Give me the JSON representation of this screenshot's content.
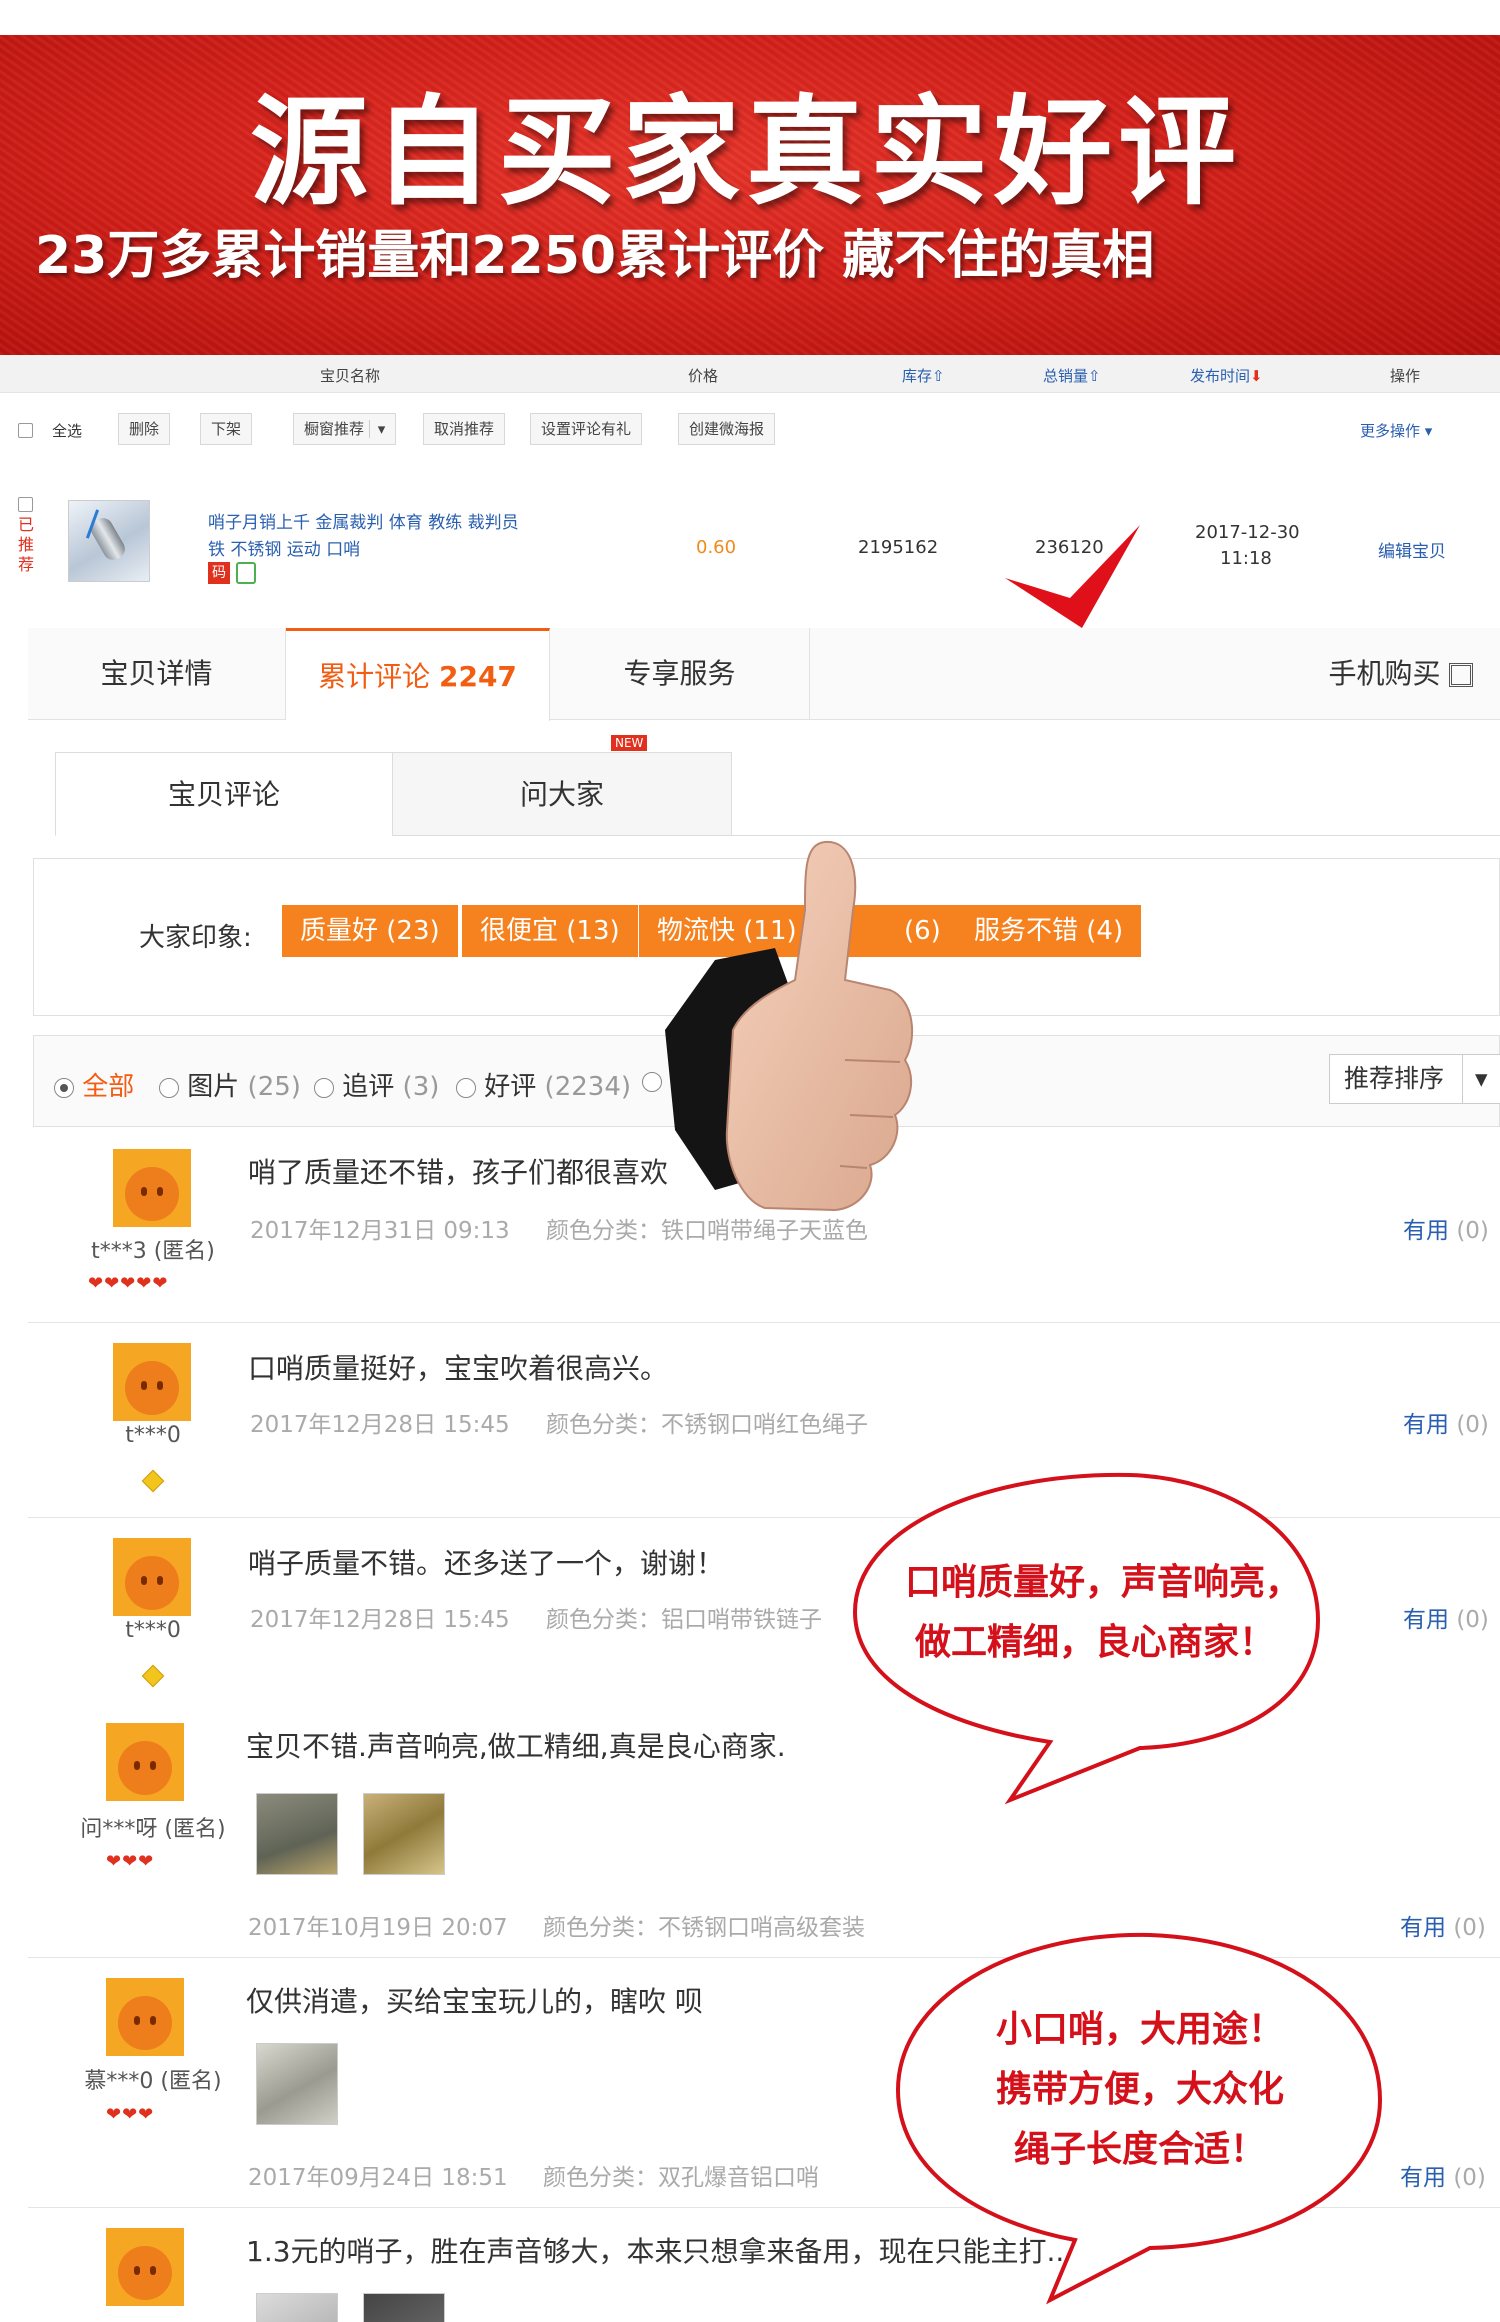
{
  "banner": {
    "title": "源自买家真实好评",
    "subtitle": "23万多累计销量和2250累计评价 藏不住的真相"
  },
  "table": {
    "headers": {
      "name": "宝贝名称",
      "price": "价格",
      "stock": "库存",
      "sales": "总销量",
      "publish_time": "发布时间",
      "ops": "操作"
    },
    "toolbar": {
      "select_all": "全选",
      "delete": "删除",
      "unlist": "下架",
      "shop_recommend": "橱窗推荐",
      "cancel_recommend": "取消推荐",
      "review_gift": "设置评论有礼",
      "create_poster": "创建微海报",
      "more_ops": "更多操作"
    },
    "row": {
      "recommended": "已推荐",
      "title_line1": "哨子月销上千 金属裁判 体育 教练 裁判员",
      "title_line2": "铁 不锈钢 运动 口哨",
      "price": "0.60",
      "stock": "2195162",
      "sales": "236120",
      "date": "2017-12-30",
      "time": "11:18",
      "edit": "编辑宝贝",
      "badge": "码"
    }
  },
  "product_tabs": {
    "details": "宝贝详情",
    "reviews_label": "累计评论",
    "reviews_count": "2247",
    "services": "专享服务",
    "mobile": "手机购买"
  },
  "review_tabs": {
    "item_reviews": "宝贝评论",
    "ask": "问大家",
    "new_badge": "NEW"
  },
  "impression": {
    "label": "大家印象:",
    "tags": [
      "质量好 (23)",
      "很便宜 (13)",
      "物流快 (11)",
      "(6)",
      "服务不错 (4)"
    ]
  },
  "filter": {
    "all": "全部",
    "pics": "图片",
    "pics_count": "(25)",
    "followup": "追评",
    "followup_count": "(3)",
    "good": "好评",
    "good_count": "(2234)",
    "sort": "推荐排序"
  },
  "reviews": [
    {
      "user": "t***3 (匿名)",
      "text": "哨了质量还不错，孩子们都很喜欢",
      "date": "2017年12月31日 09:13",
      "variant": "颜色分类：铁口哨带绳子天蓝色",
      "useful": "有用",
      "useful_count": "(0)"
    },
    {
      "user": "t***0",
      "text": "口哨质量挺好，宝宝吹着很高兴。",
      "date": "2017年12月28日 15:45",
      "variant": "颜色分类：不锈钢口哨红色绳子",
      "useful": "有用",
      "useful_count": "(0)"
    },
    {
      "user": "t***0",
      "text": "哨子质量不错。还多送了一个，谢谢！",
      "date": "2017年12月28日 15:45",
      "variant": "颜色分类：铝口哨带铁链子",
      "useful": "有用",
      "useful_count": "(0)"
    },
    {
      "user": "问***呀 (匿名)",
      "text": "宝贝不错.声音响亮,做工精细,真是良心商家.",
      "date": "2017年10月19日 20:07",
      "variant": "颜色分类：不锈钢口哨高级套装",
      "useful": "有用",
      "useful_count": "(0)"
    },
    {
      "user": "慕***0 (匿名)",
      "text": "仅供消遣，买给宝宝玩儿的，瞎吹 呗",
      "date": "2017年09月24日 18:51",
      "variant": "颜色分类：双孔爆音铝口哨",
      "useful": "有用",
      "useful_count": "(0)"
    },
    {
      "user": "",
      "text": "1.3元的哨子，胜在声音够大，本来只想拿来备用，现在只能主打..."
    }
  ],
  "bubbles": {
    "one_line1": "口哨质量好，声音响亮，",
    "one_line2": "做工精细，良心商家！",
    "two_line1": "小口哨，大用途！",
    "two_line2": "携带方便，大众化",
    "two_line3": "绳子长度合适！"
  },
  "colors": {
    "banner_red": "#d4201a",
    "accent_orange": "#f25d12",
    "tag_orange": "#f5821f",
    "link_blue": "#2a5fb0",
    "bubble_red": "#d4101a"
  }
}
